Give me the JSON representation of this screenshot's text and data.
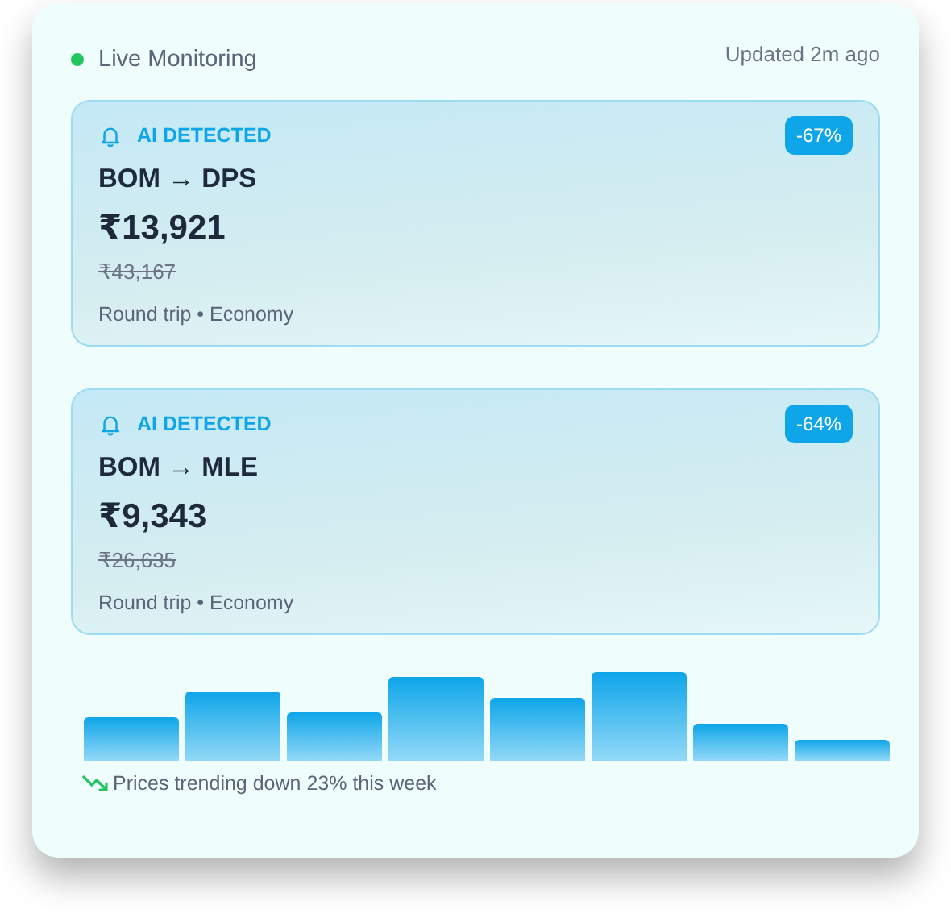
{
  "header": {
    "live": true,
    "title": "Live Monitoring",
    "updated": "Updated 2m ago"
  },
  "alerts": [
    {
      "tag": "AI DETECTED",
      "discount": "-67%",
      "route": "BOM → DPS",
      "price": "₹13,921",
      "old_price": "₹43,167",
      "details": "Round trip • Economy"
    },
    {
      "tag": "AI DETECTED",
      "discount": "-64%",
      "route": "BOM → MLE",
      "price": "₹9,343",
      "old_price": "₹26,635",
      "details": "Round trip • Economy"
    }
  ],
  "trend": {
    "falling": true,
    "text": "Prices trending down 23% this week"
  }
}
